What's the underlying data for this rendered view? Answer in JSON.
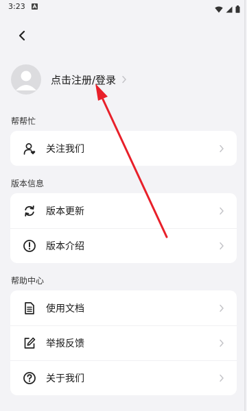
{
  "status_bar": {
    "time": "3:23",
    "indicator_icon": "app-notification-icon",
    "right_icons": [
      "wifi-icon",
      "signal-icon",
      "battery-icon"
    ]
  },
  "header": {
    "back_icon": "back-arrow-icon"
  },
  "profile": {
    "login_label": "点击注册/登录",
    "avatar_icon": "default-avatar-icon"
  },
  "sections": [
    {
      "title": "帮帮忙",
      "items": [
        {
          "label": "关注我们",
          "icon": "user-heart-icon"
        }
      ]
    },
    {
      "title": "版本信息",
      "items": [
        {
          "label": "版本更新",
          "icon": "refresh-icon"
        },
        {
          "label": "版本介绍",
          "icon": "info-circle-icon"
        }
      ]
    },
    {
      "title": "帮助中心",
      "items": [
        {
          "label": "使用文档",
          "icon": "document-icon"
        },
        {
          "label": "举报反馈",
          "icon": "edit-icon"
        },
        {
          "label": "关于我们",
          "icon": "help-circle-icon"
        }
      ]
    }
  ],
  "colors": {
    "background": "#f3f3f6",
    "card": "#ffffff",
    "annotation_arrow": "#e8202a",
    "chevron": "#c4c4c8"
  }
}
